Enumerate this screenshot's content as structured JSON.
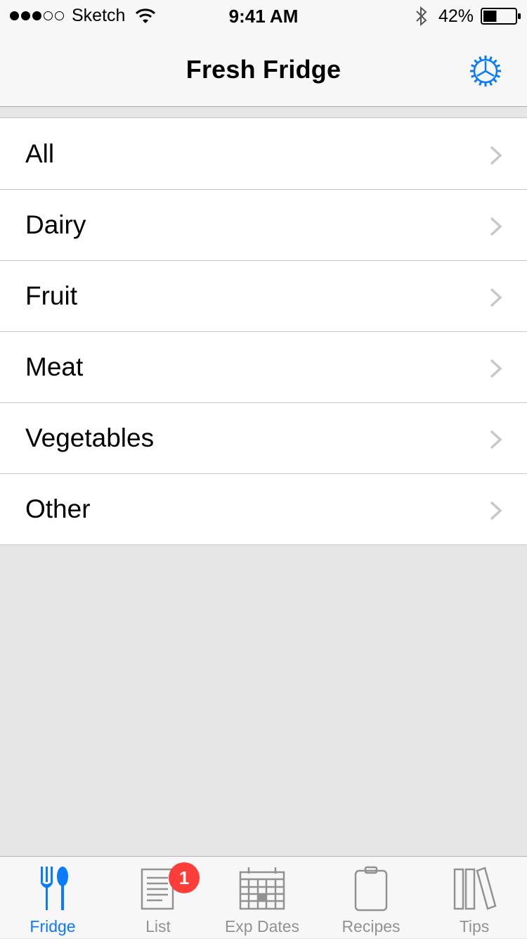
{
  "status_bar": {
    "carrier": "Sketch",
    "time": "9:41 AM",
    "battery_percent": "42%",
    "signal_bars": 3,
    "signal_total": 5,
    "battery_level": 0.42
  },
  "nav": {
    "title": "Fresh Fridge",
    "settings_icon": "gear-icon"
  },
  "categories": [
    {
      "label": "All"
    },
    {
      "label": "Dairy"
    },
    {
      "label": "Fruit"
    },
    {
      "label": "Meat"
    },
    {
      "label": "Vegetables"
    },
    {
      "label": "Other"
    }
  ],
  "tabs": [
    {
      "label": "Fridge",
      "icon": "fork-spoon-icon",
      "active": true
    },
    {
      "label": "List",
      "icon": "list-icon",
      "badge": "1"
    },
    {
      "label": "Exp Dates",
      "icon": "calendar-icon"
    },
    {
      "label": "Recipes",
      "icon": "clipboard-icon"
    },
    {
      "label": "Tips",
      "icon": "books-icon"
    }
  ],
  "colors": {
    "accent": "#0a7aff",
    "badge": "#fc3d39",
    "inactive": "#929292"
  }
}
